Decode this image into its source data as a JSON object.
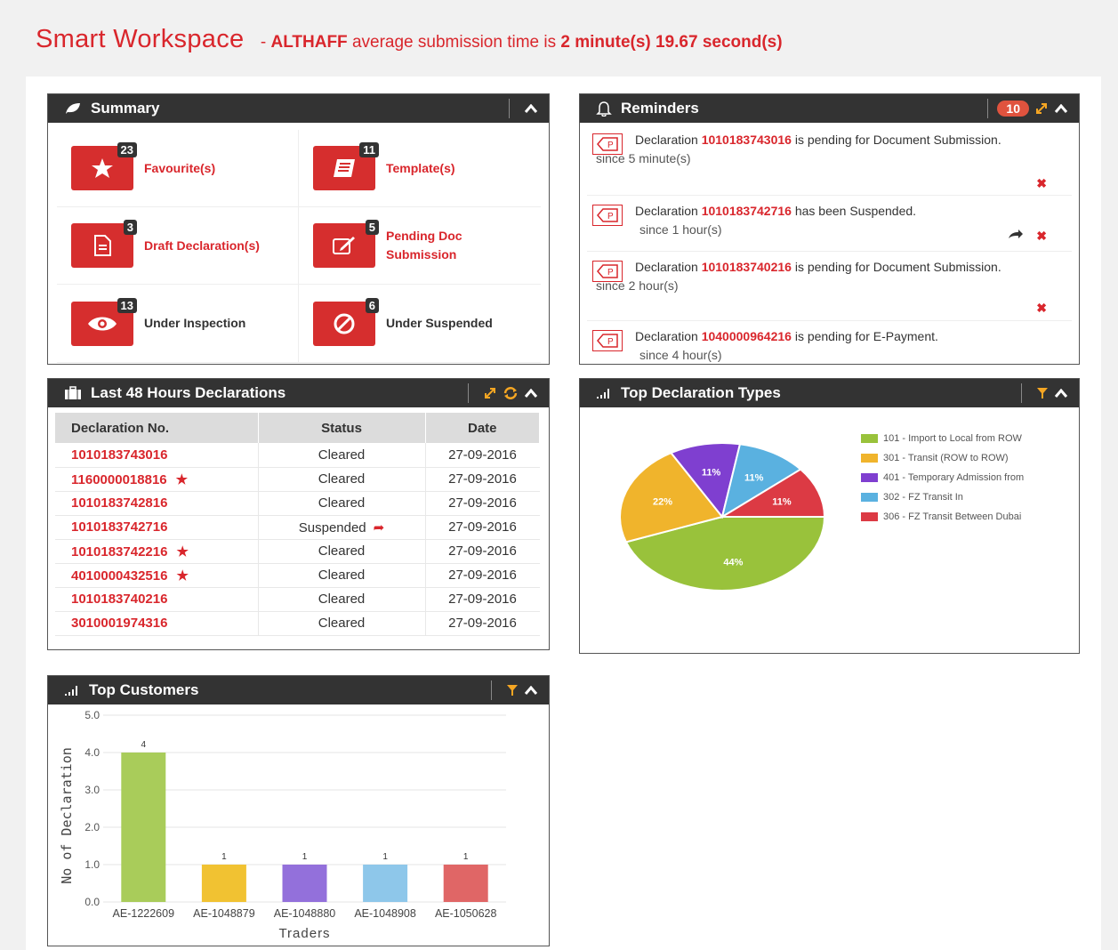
{
  "header": {
    "title": "Smart Workspace",
    "subtitle_prefix": "- ",
    "user": "ALTHAFF",
    "subtitle_mid": " average submission time is ",
    "time": "2 minute(s) 19.67 second(s)"
  },
  "summary": {
    "title": "Summary",
    "items": [
      {
        "label": "Favourite(s)",
        "count": "23"
      },
      {
        "label": "Template(s)",
        "count": "11"
      },
      {
        "label": "Draft Declaration(s)",
        "count": "3"
      },
      {
        "label": "Pending Doc Submission",
        "count": "5"
      },
      {
        "label": "Under Inspection",
        "count": "13"
      },
      {
        "label": "Under Suspended",
        "count": "6"
      }
    ]
  },
  "reminders": {
    "title": "Reminders",
    "count": "10",
    "items": [
      {
        "prefix": "Declaration ",
        "number": "1010183743016",
        "suffix": " is pending for Document Submission.",
        "since": "since 5 minute(s)"
      },
      {
        "prefix": "Declaration ",
        "number": "1010183742716",
        "suffix": " has been Suspended.",
        "since": "since 1 hour(s)"
      },
      {
        "prefix": "Declaration ",
        "number": "1010183740216",
        "suffix": " is pending for Document Submission.",
        "since": "since 2 hour(s)"
      },
      {
        "prefix": "Declaration ",
        "number": "1040000964216",
        "suffix": " is pending for E-Payment.",
        "since": "since 4 hour(s)"
      }
    ]
  },
  "declarations": {
    "title": "Last 48 Hours Declarations",
    "columns": [
      "Declaration No.",
      "Status",
      "Date"
    ],
    "rows": [
      {
        "no": "1010183743016",
        "status": "Cleared",
        "date": "27-09-2016",
        "star": false,
        "fwd": false
      },
      {
        "no": "1160000018816",
        "status": "Cleared",
        "date": "27-09-2016",
        "star": true,
        "fwd": false
      },
      {
        "no": "1010183742816",
        "status": "Cleared",
        "date": "27-09-2016",
        "star": false,
        "fwd": false
      },
      {
        "no": "1010183742716",
        "status": "Suspended",
        "date": "27-09-2016",
        "star": false,
        "fwd": true
      },
      {
        "no": "1010183742216",
        "status": "Cleared",
        "date": "27-09-2016",
        "star": true,
        "fwd": false
      },
      {
        "no": "4010000432516",
        "status": "Cleared",
        "date": "27-09-2016",
        "star": true,
        "fwd": false
      },
      {
        "no": "1010183740216",
        "status": "Cleared",
        "date": "27-09-2016",
        "star": false,
        "fwd": false
      },
      {
        "no": "3010001974316",
        "status": "Cleared",
        "date": "27-09-2016",
        "star": false,
        "fwd": false
      }
    ]
  },
  "declaration_types": {
    "title": "Top Declaration Types"
  },
  "customers": {
    "title": "Top Customers"
  },
  "colors": {
    "brand_red": "#d9262c",
    "header_dark": "#333333",
    "accent_orange": "#f5a623"
  },
  "chart_data": [
    {
      "type": "pie",
      "labels": [
        "101 - Import to Local from ROW",
        "301 - Transit (ROW to ROW)",
        "401 - Temporary Admission from",
        "302 - FZ Transit In",
        "306 - FZ Transit Between Dubai"
      ],
      "values": [
        44,
        22,
        11,
        11,
        11
      ],
      "value_labels": [
        "44%",
        "22%",
        "11%",
        "11%",
        "11%"
      ],
      "colors": [
        "#99c23b",
        "#f0b42c",
        "#7f3fd0",
        "#5ab1e0",
        "#dc3a44"
      ],
      "legend": "right"
    },
    {
      "type": "bar",
      "categories": [
        "AE-1222609",
        "AE-1048879",
        "AE-1048880",
        "AE-1048908",
        "AE-1050628"
      ],
      "values": [
        4,
        1,
        1,
        1,
        1
      ],
      "colors": [
        "#a9cc5a",
        "#f1c232",
        "#9370db",
        "#8ec7ea",
        "#e06666"
      ],
      "xlabel": "Traders",
      "ylabel": "No of Declaration",
      "ylim": [
        0,
        5
      ],
      "yticks": [
        "0.0",
        "1.0",
        "2.0",
        "3.0",
        "4.0",
        "5.0"
      ],
      "grid": true
    }
  ]
}
